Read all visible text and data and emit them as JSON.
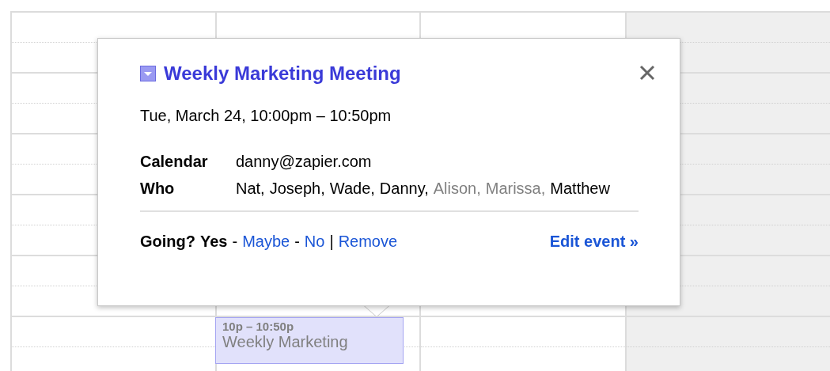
{
  "calendar": {
    "columns": [
      {
        "shaded": false
      },
      {
        "shaded": false
      },
      {
        "shaded": false
      },
      {
        "shaded": true
      }
    ],
    "event_block": {
      "time": "10p – 10:50p",
      "title": "Weekly Marketing"
    }
  },
  "popup": {
    "title": "Weekly Marketing Meeting",
    "when": "Tue, March 24, 10:00pm – 10:50pm",
    "details": [
      {
        "label": "Calendar",
        "value": "danny@zapier.com"
      }
    ],
    "who": {
      "label": "Who",
      "attendees": [
        {
          "name": "Nat,",
          "confirmed": true
        },
        {
          "name": "Joseph,",
          "confirmed": true
        },
        {
          "name": "Wade,",
          "confirmed": true
        },
        {
          "name": "Danny,",
          "confirmed": true
        },
        {
          "name": "Alison,",
          "confirmed": false
        },
        {
          "name": "Marissa,",
          "confirmed": false
        },
        {
          "name": "Matthew",
          "confirmed": true
        }
      ]
    },
    "rsvp": {
      "label": "Going?",
      "separator": "-",
      "options": [
        {
          "label": "Yes",
          "selected": true
        },
        {
          "label": "Maybe",
          "selected": false
        },
        {
          "label": "No",
          "selected": false
        }
      ]
    },
    "divider": "|",
    "remove": "Remove",
    "edit": "Edit event »"
  }
}
